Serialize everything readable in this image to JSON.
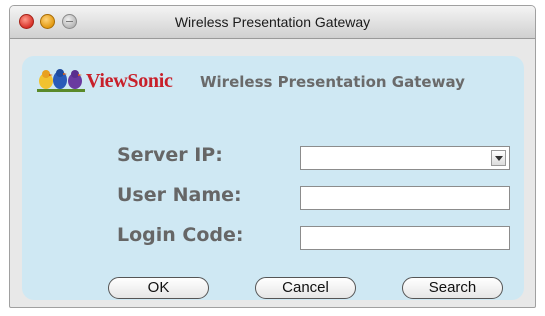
{
  "window": {
    "title": "Wireless Presentation Gateway"
  },
  "header": {
    "brand": "ViewSonic",
    "subtitle": "Wireless Presentation Gateway"
  },
  "form": {
    "server_ip_label": "Server IP:",
    "server_ip_value": "",
    "user_name_label": "User Name:",
    "user_name_value": "",
    "login_code_label": "Login Code:",
    "login_code_value": ""
  },
  "buttons": {
    "ok": "OK",
    "cancel": "Cancel",
    "search": "Search"
  },
  "colors": {
    "panel_bg": "#cfe8f3",
    "brand_red": "#c8202a",
    "label_gray": "#666666"
  },
  "icons": [
    "close-icon",
    "minimize-icon",
    "zoom-icon",
    "viewsonic-birds-logo",
    "chevron-down-icon"
  ]
}
